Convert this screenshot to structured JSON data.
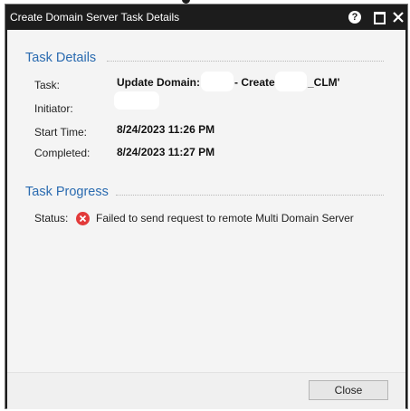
{
  "dialog": {
    "title": "Create Domain Server Task Details",
    "help_glyph": "?"
  },
  "task_details": {
    "heading": "Task Details",
    "task_label": "Task:",
    "task_value_part1": "Update Domain:",
    "task_value_part2": "- Create",
    "task_value_part3": "_CLM'",
    "initiator_label": "Initiator:",
    "start_label": "Start Time:",
    "start_value": "8/24/2023 11:26 PM",
    "completed_label": "Completed:",
    "completed_value": "8/24/2023 11:27 PM"
  },
  "task_progress": {
    "heading": "Task Progress",
    "status_label": "Status:",
    "status_icon": "error-icon",
    "status_text": "Failed to send request to remote Multi Domain Server"
  },
  "footer": {
    "close_label": "Close"
  },
  "colors": {
    "titlebar": "#1c1c1c",
    "section_heading": "#2a6bb0",
    "error": "#e23a3a"
  }
}
